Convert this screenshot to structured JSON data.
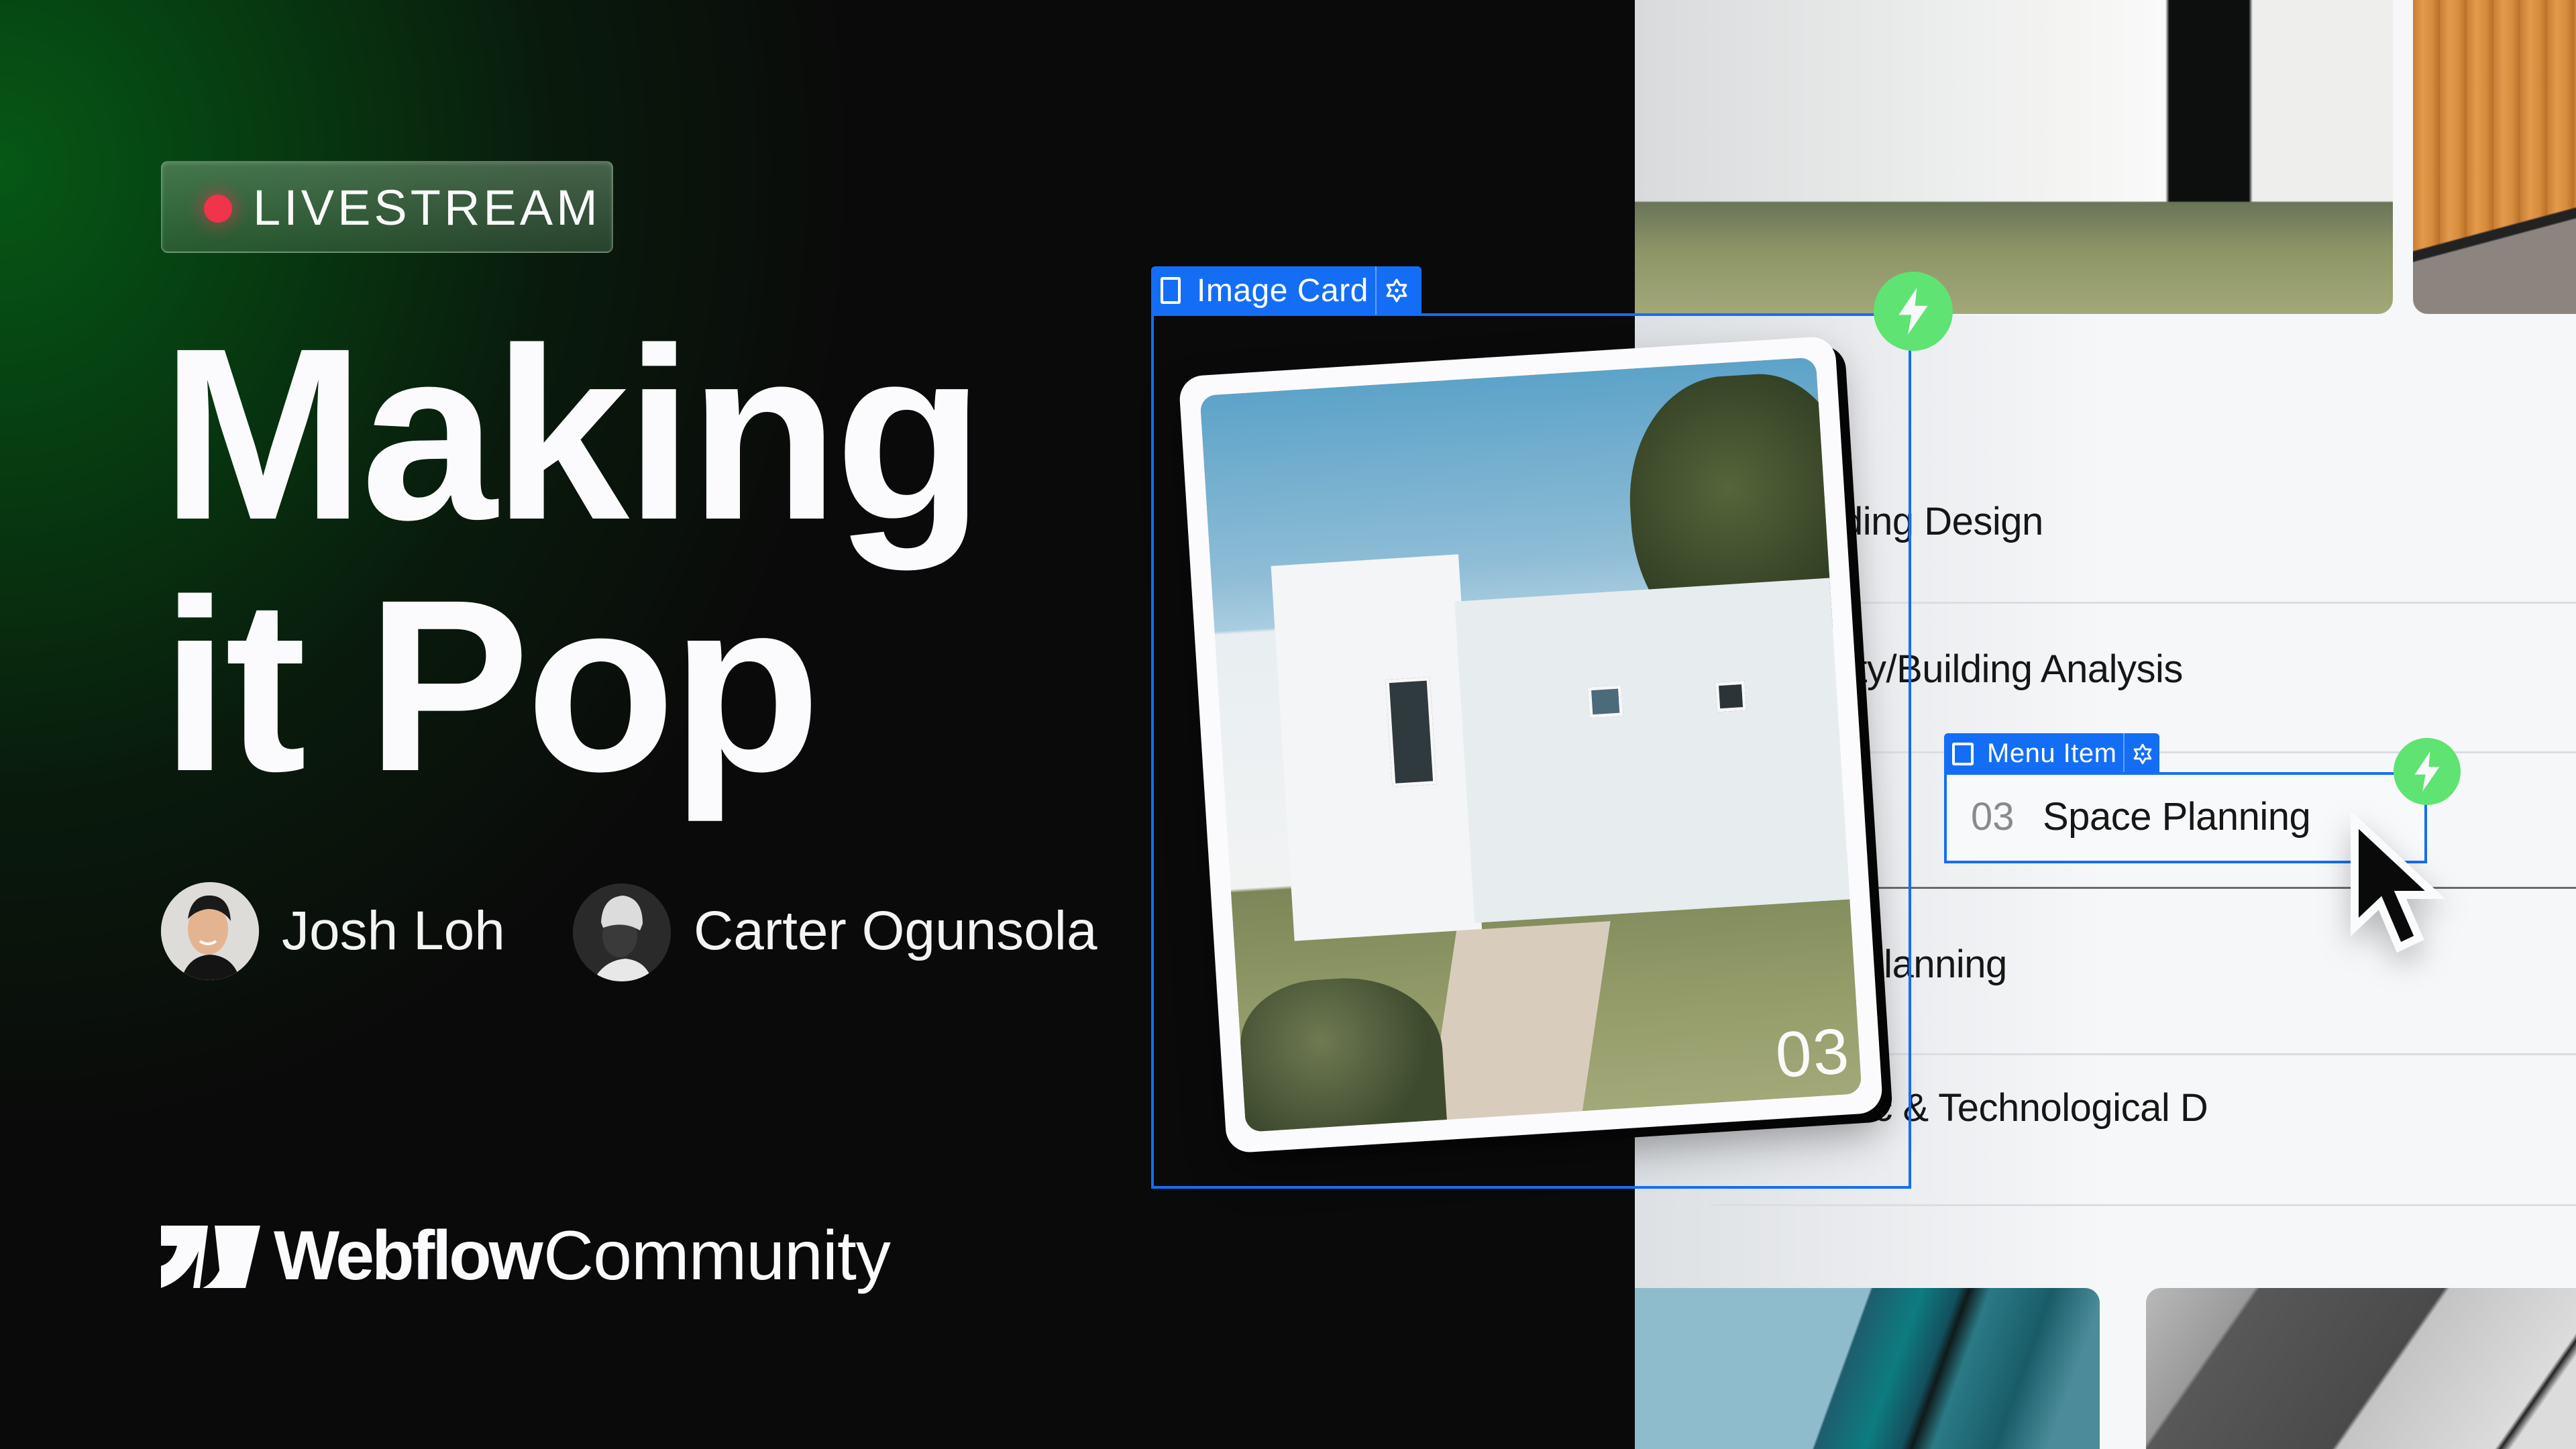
{
  "badge": {
    "label": "LIVESTREAM",
    "dot_color": "#f0344a"
  },
  "title": {
    "line1": "Making",
    "line2": "it Pop"
  },
  "hosts": [
    {
      "name": "Josh Loh",
      "avatar": "josh-loh-photo"
    },
    {
      "name": "Carter Ogunsola",
      "avatar": "carter-ogunsola-photo"
    }
  ],
  "brand": {
    "logo": "webflow-logo-icon",
    "name_bold": "Webflow",
    "name_regular": "Community"
  },
  "designer": {
    "selection_color": "#146ef5",
    "interaction_color": "#5fe372",
    "image_card": {
      "tab_label": "Image Card",
      "number": "03"
    },
    "menu_item": {
      "tab_label": "Menu Item",
      "number": "03",
      "label": "Space Planning"
    },
    "list_items": [
      "ding Design",
      "ity/Building Analysis",
      "Planning",
      "ic & Technological D"
    ]
  }
}
